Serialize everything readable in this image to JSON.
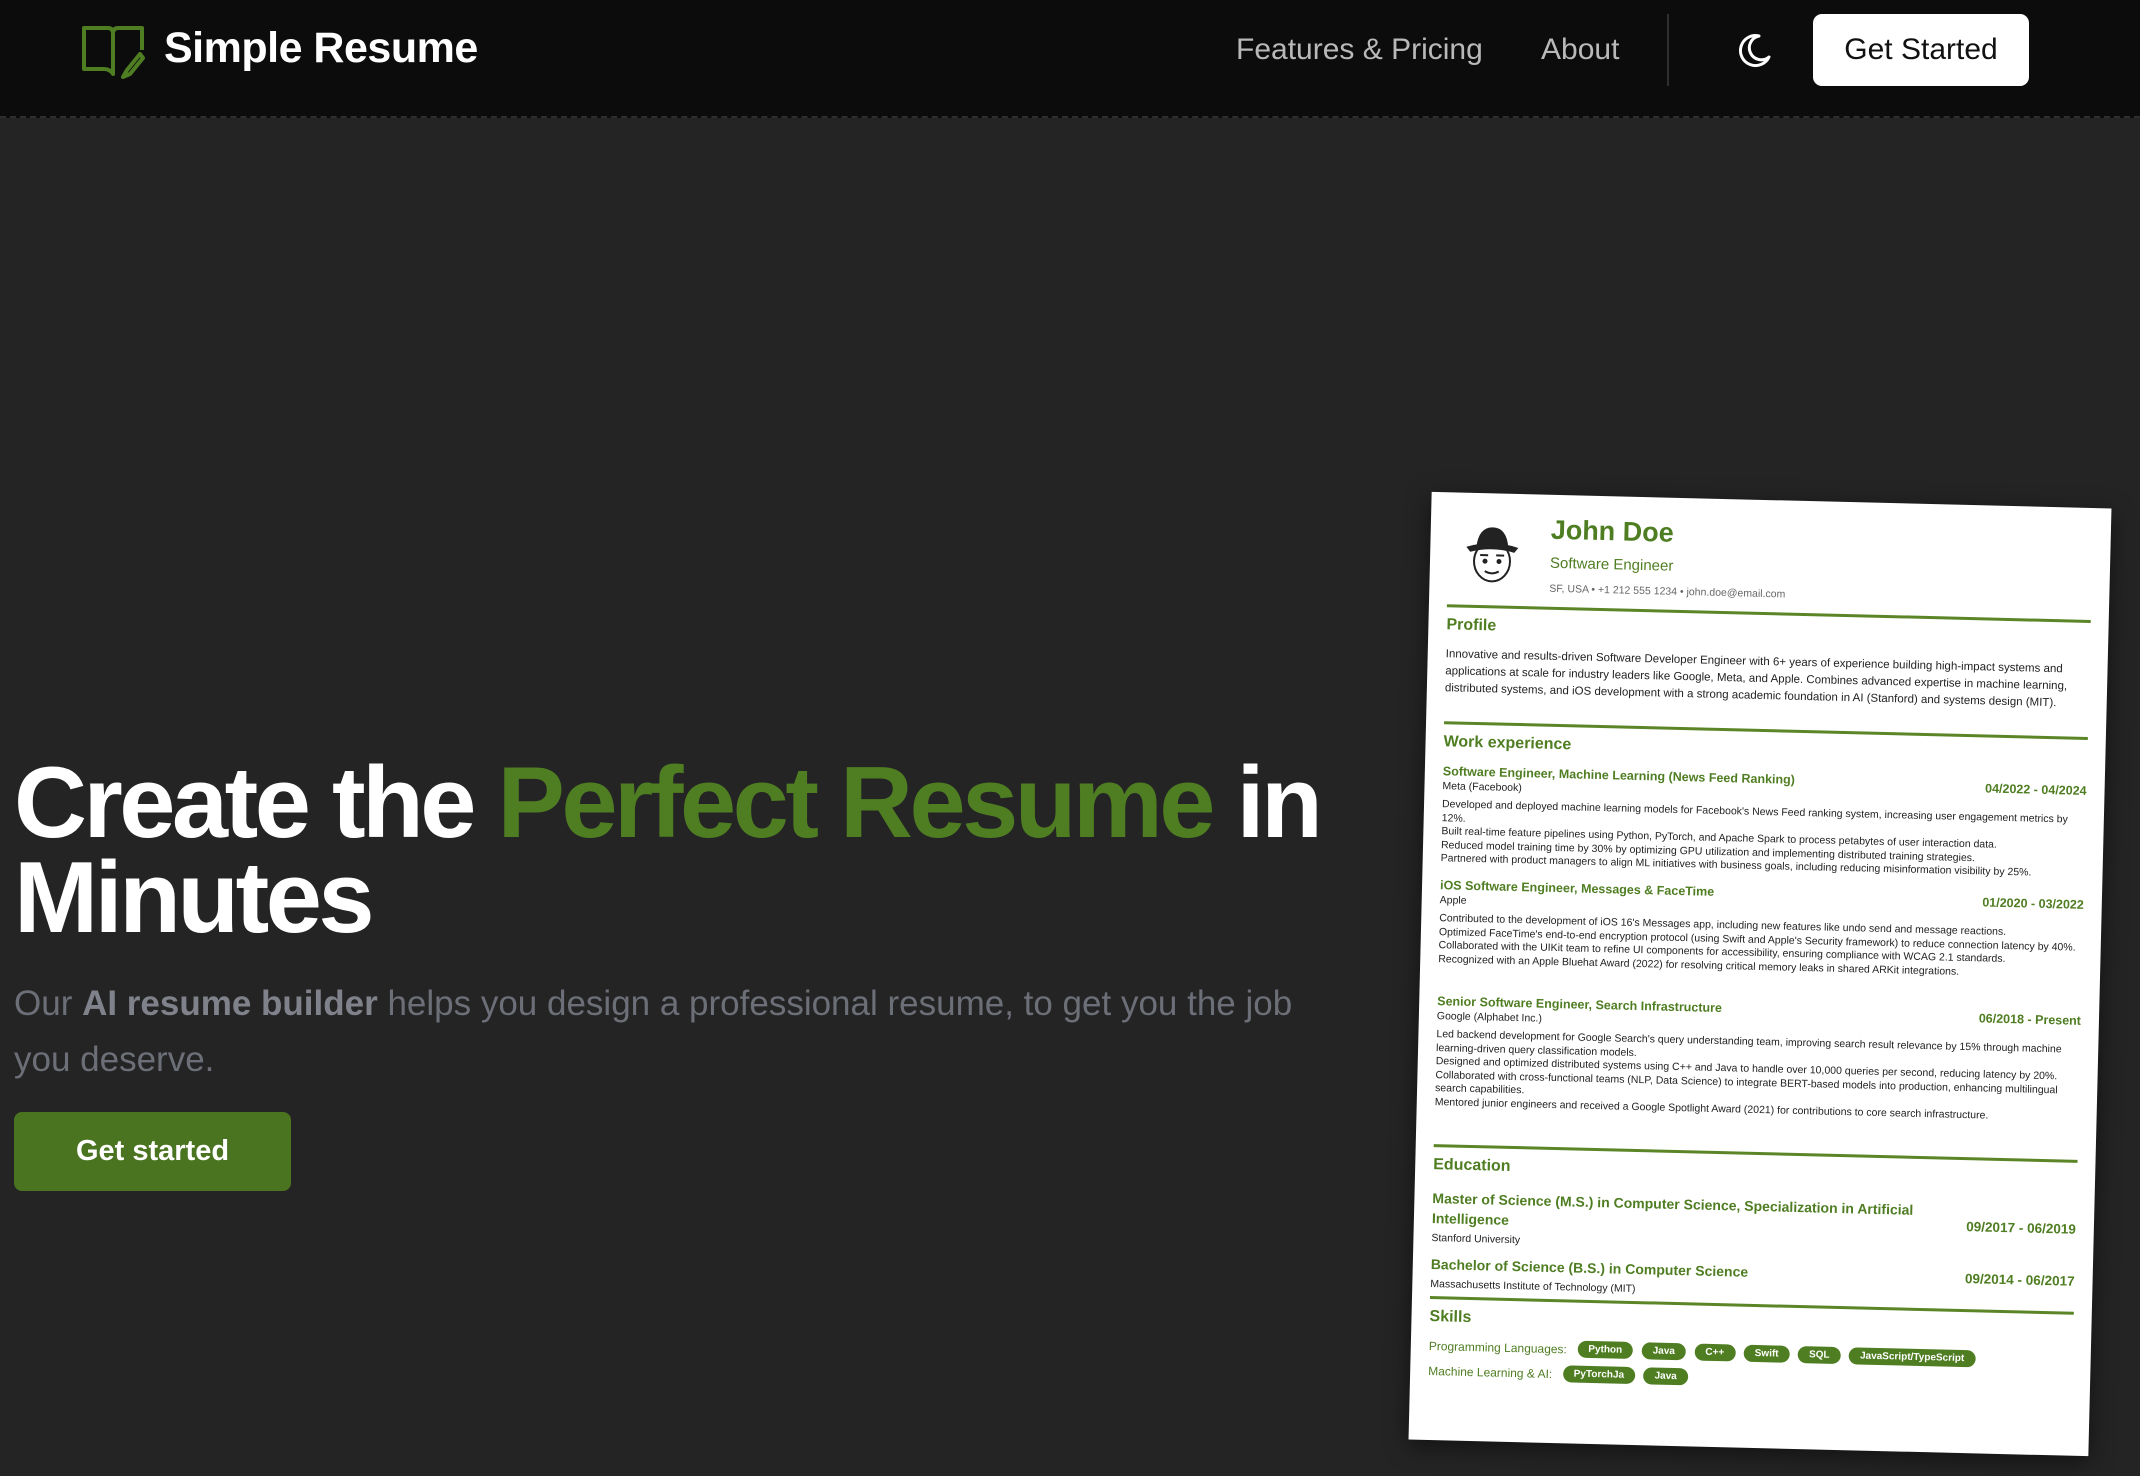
{
  "header": {
    "brand": "Simple Resume",
    "nav": {
      "features": "Features & Pricing",
      "about": "About"
    },
    "theme_toggle_icon": "moon-icon",
    "cta": "Get Started"
  },
  "hero": {
    "title_prefix": "Create the ",
    "title_highlight": "Perfect Resume",
    "title_suffix": " in Minutes",
    "subtitle_prefix": "Our ",
    "subtitle_bold": "AI resume builder",
    "subtitle_suffix": " helps you design a professional resume, to get you the job you deserve.",
    "cta": "Get started",
    "accent_color": "#4f7d22"
  },
  "resume": {
    "name": "John Doe",
    "role": "Software Engineer",
    "contact": "SF, USA • +1 212 555 1234 • john.doe@email.com",
    "sections": {
      "profile": "Profile",
      "work": "Work experience",
      "education": "Education",
      "skills": "Skills"
    },
    "profile_text": "Innovative and results-driven Software Developer Engineer with 6+ years of experience building high-impact systems and applications at scale for industry leaders like Google, Meta, and Apple. Combines advanced expertise in machine learning, distributed systems, and iOS development with a strong academic foundation in AI (Stanford) and systems design (MIT).",
    "jobs": [
      {
        "title": "Software Engineer, Machine Learning (News Feed Ranking)",
        "company": "Meta (Facebook)",
        "dates": "04/2022 - 04/2024",
        "bullets": [
          "Developed and deployed machine learning models for Facebook's News Feed ranking system, increasing user engagement metrics by 12%.",
          "Built real-time feature pipelines using Python, PyTorch, and Apache Spark to process petabytes of user interaction data.",
          "Reduced model training time by 30% by optimizing GPU utilization and implementing distributed training strategies.",
          "Partnered with product managers to align ML initiatives with business goals, including reducing misinformation visibility by 25%."
        ]
      },
      {
        "title": "iOS Software Engineer, Messages & FaceTime",
        "company": "Apple",
        "dates": "01/2020 - 03/2022",
        "bullets": [
          "Contributed to the development of iOS 16's Messages app, including new features like undo send and message reactions.",
          "Optimized FaceTime's end-to-end encryption protocol (using Swift and Apple's Security framework) to reduce connection latency by 40%.",
          "Collaborated with the UIKit team to refine UI components for accessibility, ensuring compliance with WCAG 2.1 standards.",
          "Recognized with an Apple Bluehat Award (2022) for resolving critical memory leaks in shared ARKit integrations."
        ]
      },
      {
        "title": "Senior Software Engineer, Search Infrastructure",
        "company": "Google (Alphabet Inc.)",
        "dates": "06/2018 - Present",
        "bullets": [
          "Led backend development for Google Search's query understanding team, improving search result relevance by 15% through machine learning-driven query classification models.",
          "Designed and optimized distributed systems using C++ and Java to handle over 10,000 queries per second, reducing latency by 20%.",
          "Collaborated with cross-functional teams (NLP, Data Science) to integrate BERT-based models into production, enhancing multilingual search capabilities.",
          "Mentored junior engineers and received a Google Spotlight Award (2021) for contributions to core search infrastructure."
        ]
      }
    ],
    "education": [
      {
        "degree": "Master of Science (M.S.) in Computer Science, Specialization in Artificial Intelligence",
        "school": "Stanford University",
        "dates": "09/2017 - 06/2019"
      },
      {
        "degree": "Bachelor of Science (B.S.) in Computer Science",
        "school": "Massachusetts Institute of Technology (MIT)",
        "dates": "09/2014 - 06/2017"
      }
    ],
    "skills": {
      "programming_label": "Programming Languages:",
      "programming": [
        "Python",
        "Java",
        "C++",
        "Swift",
        "SQL",
        "JavaScript/TypeScript"
      ],
      "ml_label": "Machine Learning & AI:",
      "ml": [
        "PyTorchJa",
        "Java"
      ]
    }
  }
}
